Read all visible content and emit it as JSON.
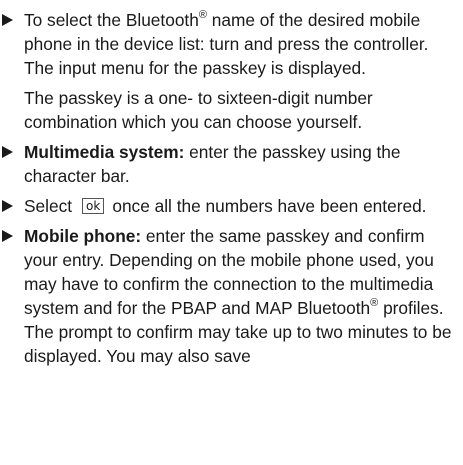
{
  "steps": [
    {
      "id": "select-name",
      "prefix": "To select the Bluetooth",
      "reg": "®",
      "suffix": " name of the desired mobile phone in the device list: turn and press the controller."
    },
    {
      "id": "multimedia",
      "bold": "Multimedia system:",
      "text": " enter the passkey using the character bar."
    },
    {
      "id": "select-ok",
      "before": "Select",
      "key": "ok",
      "after": "once all the numbers have been entered."
    },
    {
      "id": "mobile",
      "bold": "Mobile phone:",
      "text1": " enter the same passkey and confirm your entry. Depending on the mobile phone used, you may have to confirm the connection to the multimedia system and for the PBAP and MAP Bluetooth",
      "reg": "®",
      "text2": " profiles. The prompt to confirm may take up to two minutes to be displayed. You may also save"
    }
  ],
  "notes": {
    "input_menu": "The input menu for the passkey is displayed.",
    "passkey_info": "The passkey is a one- to sixteen-digit number combination which you can choose yourself."
  }
}
